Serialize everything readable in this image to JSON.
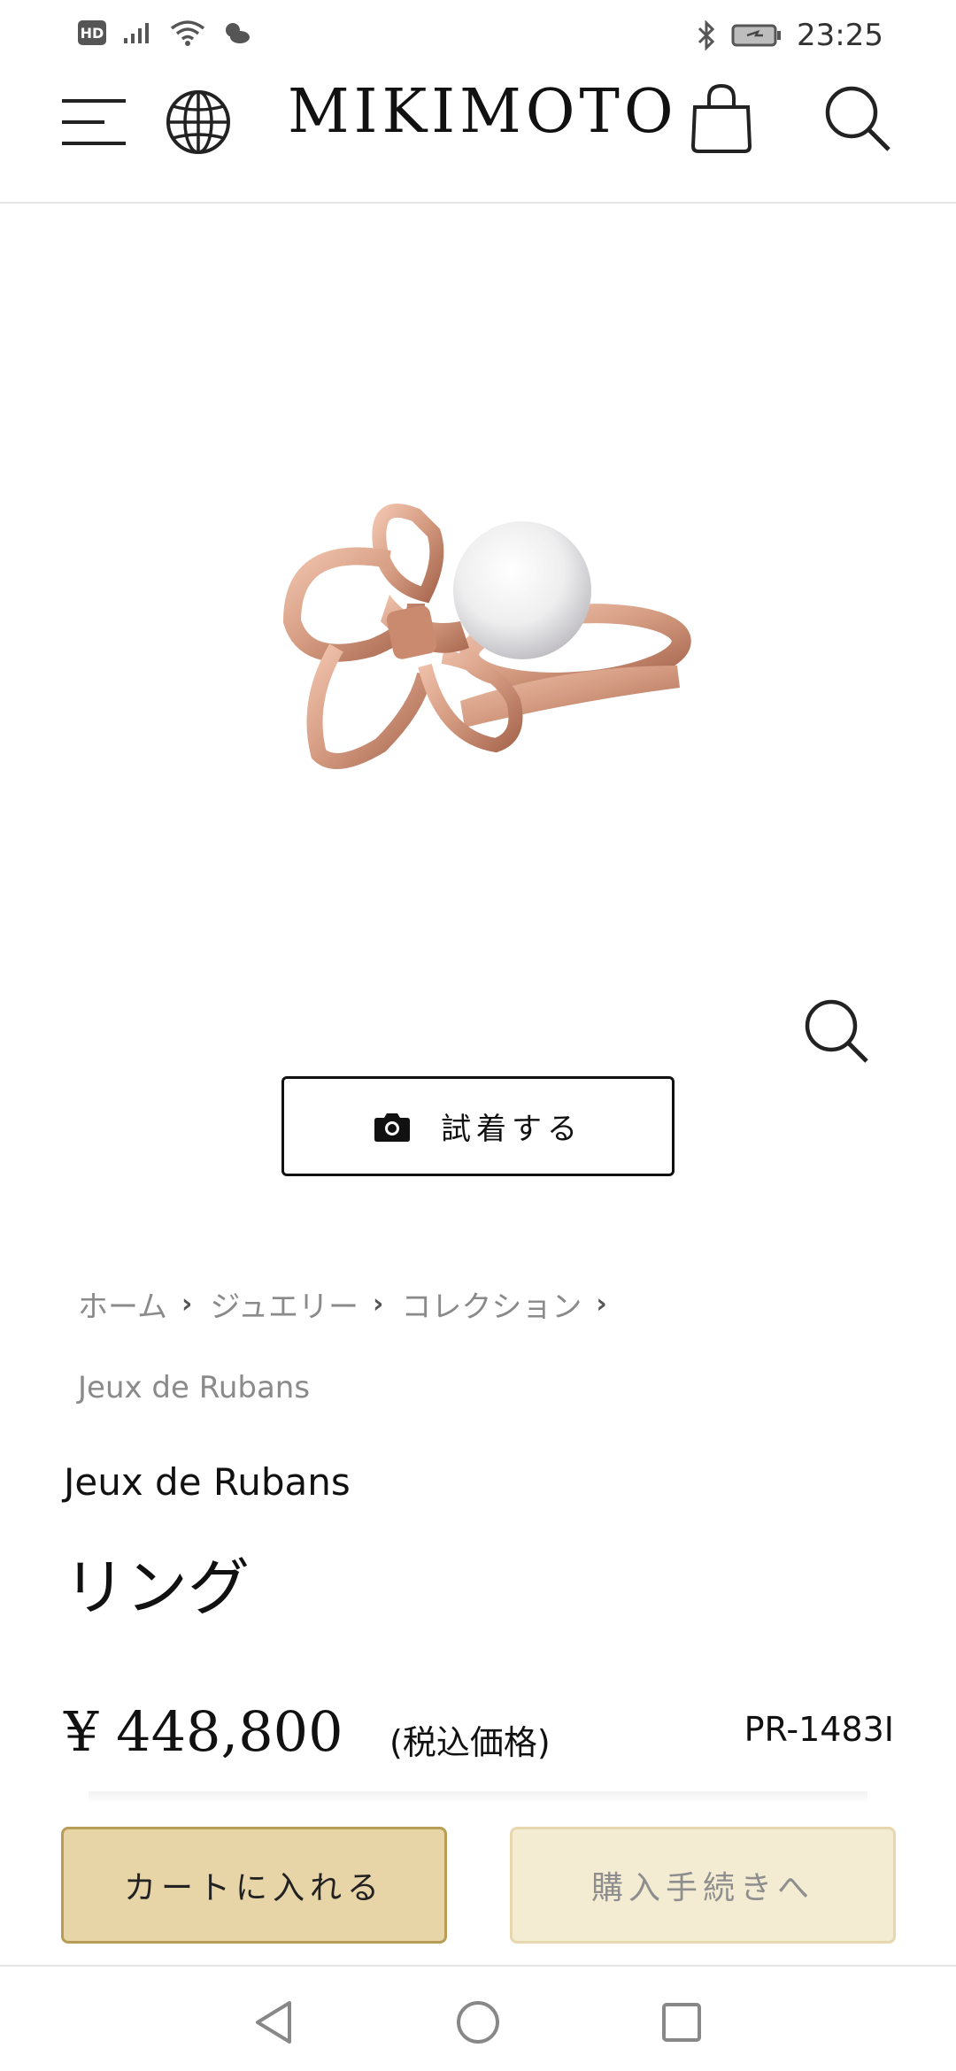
{
  "status_bar": {
    "hd_badge": "HD",
    "time": "23:25"
  },
  "header": {
    "logo": "MIKIMOTO",
    "icons": [
      "menu-icon",
      "globe-icon",
      "shopping-bag-icon",
      "search-icon"
    ]
  },
  "product": {
    "try_on_label": "試着する",
    "breadcrumb": [
      "ホーム",
      "ジュエリー",
      "コレクション"
    ],
    "breadcrumb_current": "Jeux de Rubans",
    "collection": "Jeux de Rubans",
    "title": "リング",
    "price": "¥ 448,800",
    "tax_note": "(税込価格)",
    "sku": "PR-1483I"
  },
  "actions": {
    "add_to_cart": "カートに入れる",
    "checkout": "購入手続きへ"
  },
  "colors": {
    "add_to_cart_bg": "#e7d5a8",
    "checkout_bg": "#f4ebd3",
    "rose_gold": "#d39a80",
    "pearl": "#f2f2f2"
  }
}
